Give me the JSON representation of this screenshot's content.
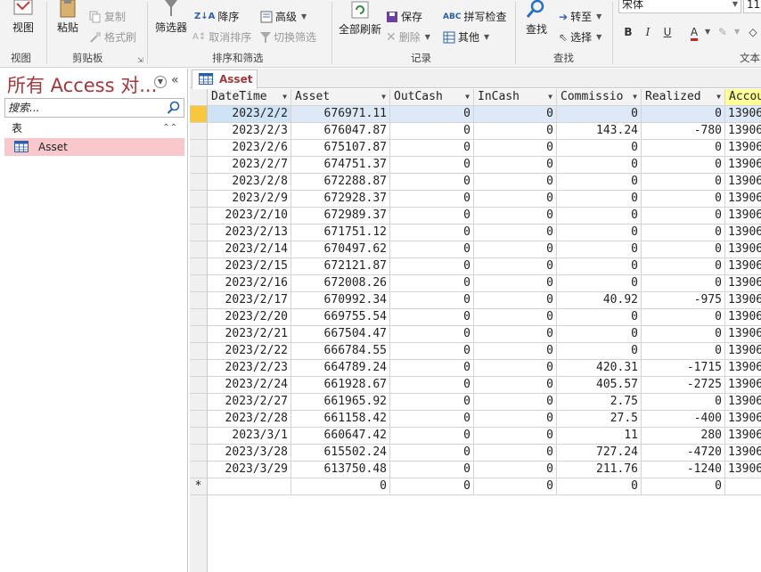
{
  "ribbon": {
    "view": {
      "label": "视图",
      "group": "视图"
    },
    "clipboard": {
      "paste": "粘贴",
      "copy": "复制",
      "format_painter": "格式刷",
      "group": "剪贴板"
    },
    "sort_filter": {
      "filter": "筛选器",
      "descending": "降序",
      "advanced": "高级",
      "remove_sort": "取消排序",
      "toggle_filter": "切换筛选",
      "group": "排序和筛选"
    },
    "records": {
      "refresh_all": "全部刷新",
      "save": "保存",
      "spelling": "拼写检查",
      "delete": "删除",
      "more": "其他",
      "group": "记录"
    },
    "find": {
      "find": "查找",
      "goto": "转至",
      "select": "选择",
      "group": "查找"
    },
    "text_format": {
      "font_name": "宋体",
      "font_size": "11",
      "bold": "B",
      "italic": "I",
      "underline": "U",
      "group": "文本"
    }
  },
  "nav": {
    "title": "所有 Access 对...",
    "search_placeholder": "搜索...",
    "group_label": "表",
    "items": [
      {
        "label": "Asset"
      }
    ]
  },
  "document": {
    "tab_label": "Asset",
    "new_record_marker": "*",
    "columns": [
      "DateTime",
      "Asset",
      "OutCash",
      "InCash",
      "Commissio",
      "Realized",
      "Accou"
    ],
    "rows": [
      [
        "2023/2/2",
        "676971.11",
        "0",
        "0",
        "0",
        "0",
        "13906"
      ],
      [
        "2023/2/3",
        "676047.87",
        "0",
        "0",
        "143.24",
        "-780",
        "13906"
      ],
      [
        "2023/2/6",
        "675107.87",
        "0",
        "0",
        "0",
        "0",
        "13906"
      ],
      [
        "2023/2/7",
        "674751.37",
        "0",
        "0",
        "0",
        "0",
        "13906"
      ],
      [
        "2023/2/8",
        "672288.87",
        "0",
        "0",
        "0",
        "0",
        "13906"
      ],
      [
        "2023/2/9",
        "672928.37",
        "0",
        "0",
        "0",
        "0",
        "13906"
      ],
      [
        "2023/2/10",
        "672989.37",
        "0",
        "0",
        "0",
        "0",
        "13906"
      ],
      [
        "2023/2/13",
        "671751.12",
        "0",
        "0",
        "0",
        "0",
        "13906"
      ],
      [
        "2023/2/14",
        "670497.62",
        "0",
        "0",
        "0",
        "0",
        "13906"
      ],
      [
        "2023/2/15",
        "672121.87",
        "0",
        "0",
        "0",
        "0",
        "13906"
      ],
      [
        "2023/2/16",
        "672008.26",
        "0",
        "0",
        "0",
        "0",
        "13906"
      ],
      [
        "2023/2/17",
        "670992.34",
        "0",
        "0",
        "40.92",
        "-975",
        "13906"
      ],
      [
        "2023/2/20",
        "669755.54",
        "0",
        "0",
        "0",
        "0",
        "13906"
      ],
      [
        "2023/2/21",
        "667504.47",
        "0",
        "0",
        "0",
        "0",
        "13906"
      ],
      [
        "2023/2/22",
        "666784.55",
        "0",
        "0",
        "0",
        "0",
        "13906"
      ],
      [
        "2023/2/23",
        "664789.24",
        "0",
        "0",
        "420.31",
        "-1715",
        "13906"
      ],
      [
        "2023/2/24",
        "661928.67",
        "0",
        "0",
        "405.57",
        "-2725",
        "13906"
      ],
      [
        "2023/2/27",
        "661965.92",
        "0",
        "0",
        "2.75",
        "0",
        "13906"
      ],
      [
        "2023/2/28",
        "661158.42",
        "0",
        "0",
        "27.5",
        "-400",
        "13906"
      ],
      [
        "2023/3/1",
        "660647.42",
        "0",
        "0",
        "11",
        "280",
        "13906"
      ],
      [
        "2023/3/28",
        "615502.24",
        "0",
        "0",
        "727.24",
        "-4720",
        "13906"
      ],
      [
        "2023/3/29",
        "613750.48",
        "0",
        "0",
        "211.76",
        "-1240",
        "13906"
      ]
    ],
    "new_row": [
      "",
      "0",
      "0",
      "0",
      "0",
      "0",
      "0"
    ]
  },
  "colors": {
    "accent": "#a4373a",
    "nav_selected": "#f9c8cc",
    "current_row_selector": "#f8c83a"
  }
}
